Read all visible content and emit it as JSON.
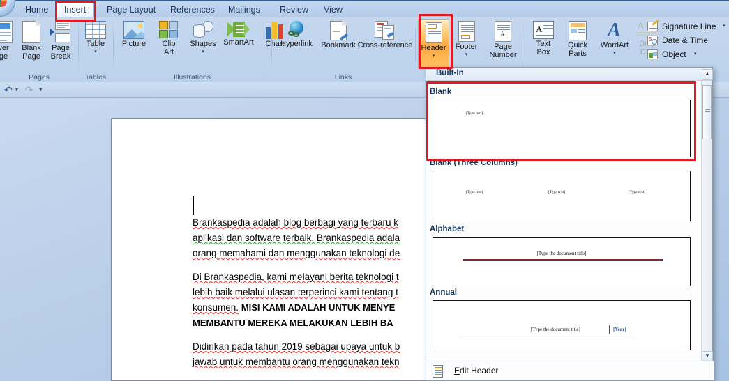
{
  "window": {
    "app": "Microsoft Word 2007"
  },
  "ribbon": {
    "tabs": [
      {
        "label": "Home",
        "active": false
      },
      {
        "label": "Insert",
        "active": true
      },
      {
        "label": "Page Layout",
        "active": false
      },
      {
        "label": "References",
        "active": false
      },
      {
        "label": "Mailings",
        "active": false
      },
      {
        "label": "Review",
        "active": false
      },
      {
        "label": "View",
        "active": false
      }
    ],
    "groups": [
      {
        "name": "Pages",
        "label": "Pages"
      },
      {
        "name": "Tables",
        "label": "Tables"
      },
      {
        "name": "Illustrations",
        "label": "Illustrations"
      },
      {
        "name": "Links",
        "label": "Links"
      },
      {
        "name": "HeaderFooter",
        "label": ""
      },
      {
        "name": "Text",
        "label": ""
      }
    ],
    "buttons": {
      "cover_page": {
        "label_line1": "ver",
        "label_line2": "ge",
        "caret": "▾"
      },
      "blank_page": {
        "label_line1": "Blank",
        "label_line2": "Page"
      },
      "page_break": {
        "label_line1": "Page",
        "label_line2": "Break"
      },
      "table": {
        "label_line1": "Table",
        "caret": "▾"
      },
      "picture": {
        "label_line1": "Picture"
      },
      "clip_art": {
        "label_line1": "Clip",
        "label_line2": "Art"
      },
      "shapes": {
        "label_line1": "Shapes",
        "caret": "▾"
      },
      "smartart": {
        "label_line1": "SmartArt"
      },
      "chart": {
        "label_line1": "Chart"
      },
      "hyperlink": {
        "label_line1": "Hyperlink"
      },
      "bookmark": {
        "label_line1": "Bookmark"
      },
      "cross_reference": {
        "label_line1": "Cross-reference"
      },
      "header": {
        "label_line1": "Header",
        "caret": "▾",
        "selected": true
      },
      "footer": {
        "label_line1": "Footer",
        "caret": "▾"
      },
      "page_number": {
        "label_line1": "Page",
        "label_line2": "Number",
        "caret": "▾"
      },
      "text_box": {
        "label_line1": "Text",
        "label_line2": "Box",
        "caret": "▾"
      },
      "quick_parts": {
        "label_line1": "Quick",
        "label_line2": "Parts",
        "caret": "▾"
      },
      "wordart": {
        "label_line1": "WordArt",
        "caret": "▾"
      },
      "drop_cap": {
        "label_line1": "Drop",
        "label_line2": "Cap",
        "caret": "▾",
        "disabled": true
      },
      "signature_line": {
        "label": "Signature Line",
        "caret": "▾"
      },
      "date_time": {
        "label": "Date & Time"
      },
      "object": {
        "label": "Object",
        "caret": "▾"
      }
    }
  },
  "quick_access": {
    "undo": "↶",
    "undo_caret": "▾",
    "redo": "↷",
    "customize_caret": "▾"
  },
  "document": {
    "caret_visible": true,
    "paragraphs": [
      {
        "lines": [
          "Brankaspedia  adalah  blog  berbagi  yang  terbaru  k",
          "aplikasi  dan  software  terbaik.  Brankaspedia   adala",
          "orang  memahami  dan  menggunakan  teknologi  de"
        ],
        "bold": false
      },
      {
        "lines": [
          "Di Brankaspedia,  kami melayani  berita  teknologi  t",
          "lebih  baik  melalui  ulasan  terperinci  kami tentang  t",
          "konsumen."
        ],
        "bold": false,
        "bold_tail": [
          "MISI KAMI ADALAH UNTUK MENYE",
          "MEMBANTU MEREKA MELAKUKAN LEBIH BA"
        ]
      },
      {
        "lines": [
          "Didirikan  pada  tahun  2019  sebagai   upaya  untuk  b",
          "jawab untuk  membantu  orang  menggunakan  tekn"
        ],
        "bold": false
      }
    ]
  },
  "gallery": {
    "header": "Built-In",
    "sections": [
      {
        "name": "Blank",
        "label": "Blank",
        "highlighted": true,
        "placeholders": [
          {
            "text": "[Type text]",
            "align": "left"
          }
        ]
      },
      {
        "name": "Blank (Three Columns)",
        "label": "Blank (Three Columns)",
        "highlighted": false,
        "placeholders": [
          {
            "text": "[Type text]",
            "align": "left"
          },
          {
            "text": "[Type text]",
            "align": "center"
          },
          {
            "text": "[Type text]",
            "align": "right"
          }
        ]
      },
      {
        "name": "Alphabet",
        "label": "Alphabet",
        "highlighted": false,
        "placeholders": [
          {
            "text": "[Type the document title]",
            "align": "center"
          }
        ],
        "rule_color": "#7b2d2d"
      },
      {
        "name": "Annual",
        "label": "Annual",
        "highlighted": false,
        "placeholders": [
          {
            "text": "[Type the document title]",
            "align": "right"
          },
          {
            "text": "[Year]",
            "align": "right",
            "color": "#2e5c8a"
          }
        ],
        "rule_color": "#8a8a8a"
      }
    ],
    "scrollbar": {
      "up_arrow": "▲",
      "down_arrow": "▼"
    },
    "footer": {
      "label": "Edit Header",
      "icon": "header-doc-icon"
    }
  },
  "annotations": {
    "highlight_color": "#e01b24",
    "boxes": [
      {
        "name": "insert-tab-highlight",
        "target": "tab-insert"
      },
      {
        "name": "header-button-highlight",
        "target": "header-button"
      },
      {
        "name": "blank-header-highlight",
        "target": "gallery-section-blank"
      }
    ]
  }
}
